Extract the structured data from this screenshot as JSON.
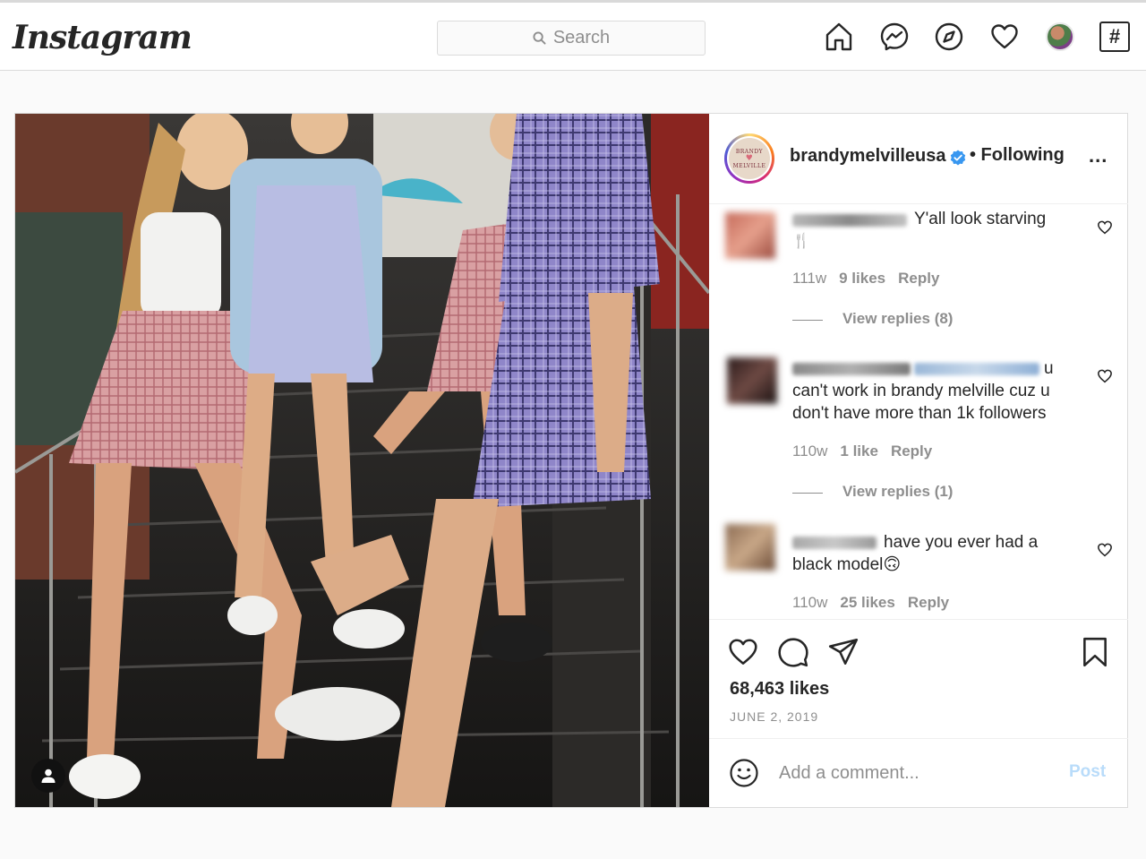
{
  "header": {
    "logo": "Instagram",
    "search_placeholder": "Search",
    "nav_icons": [
      "home-icon",
      "messenger-icon",
      "explore-compass-icon",
      "activity-heart-icon",
      "profile-avatar",
      "hashtag-icon"
    ],
    "hash_glyph": "#"
  },
  "post": {
    "account": {
      "username": "brandymelvilleusa",
      "verified": true,
      "follow_status": "• Following",
      "more_glyph": "...",
      "avatar_text_top": "BRANDY",
      "avatar_text_bottom": "MELVILLE"
    },
    "comments": [
      {
        "text_line1": "Y'all look starving",
        "text_line2": "🍴",
        "age": "111w",
        "likes": "9 likes",
        "reply": "Reply",
        "view_replies": "View replies (8)"
      },
      {
        "text_line1": "u",
        "text_line2": "can't work in brandy melville cuz u",
        "text_line3": "don't have more than 1k followers",
        "age": "110w",
        "likes": "1 like",
        "reply": "Reply",
        "view_replies": "View replies (1)"
      },
      {
        "text_line1": "have you ever had a",
        "text_line2": "black model🙃",
        "age": "110w",
        "likes": "25 likes",
        "reply": "Reply"
      }
    ],
    "likes_count": "68,463 likes",
    "date": "JUNE 2, 2019",
    "add_comment_placeholder": "Add a comment...",
    "post_button": "Post"
  },
  "colors": {
    "link_disabled": "#b9dcfa",
    "verified_blue": "#3897f0",
    "secondary_text": "#8e8e8e"
  }
}
